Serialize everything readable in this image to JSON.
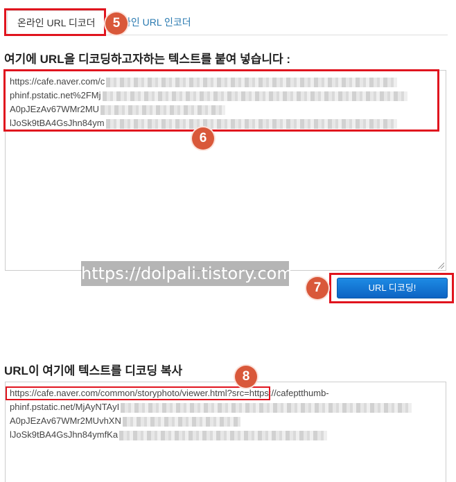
{
  "tabs": {
    "decoder": "온라인 URL 디코더",
    "encoder": "라인 URL 인코더"
  },
  "input_section": {
    "heading": "여기에 URL을 디코딩하고자하는 텍스트를 붙여 넣습니다 :",
    "lines": [
      "https://cafe.naver.com/c",
      "phinf.pstatic.net%2FMj",
      "A0pJEzAv67WMr2MU",
      "lJoSk9tBA4GsJhn84ym"
    ]
  },
  "decode_button": "URL 디코딩!",
  "watermark": "https://dolpali.tistory.com",
  "output_section": {
    "heading": "URL이 여기에 텍스트를 디코딩 복사",
    "lines": [
      "https://cafe.naver.com/common/storyphoto/viewer.html?src=https://cafeptthumb-",
      "phinf.pstatic.net/MjAyNTAyI",
      "A0pJEzAv67WMr2MUvhXN",
      "lJoSk9tBA4GsJhn84ymfKa"
    ]
  },
  "badges": [
    "5",
    "6",
    "7",
    "8"
  ],
  "colors": {
    "annotation_red": "#e0141e",
    "badge": "#d9583a",
    "button": "#0d63c3",
    "link": "#2a7ab0"
  }
}
